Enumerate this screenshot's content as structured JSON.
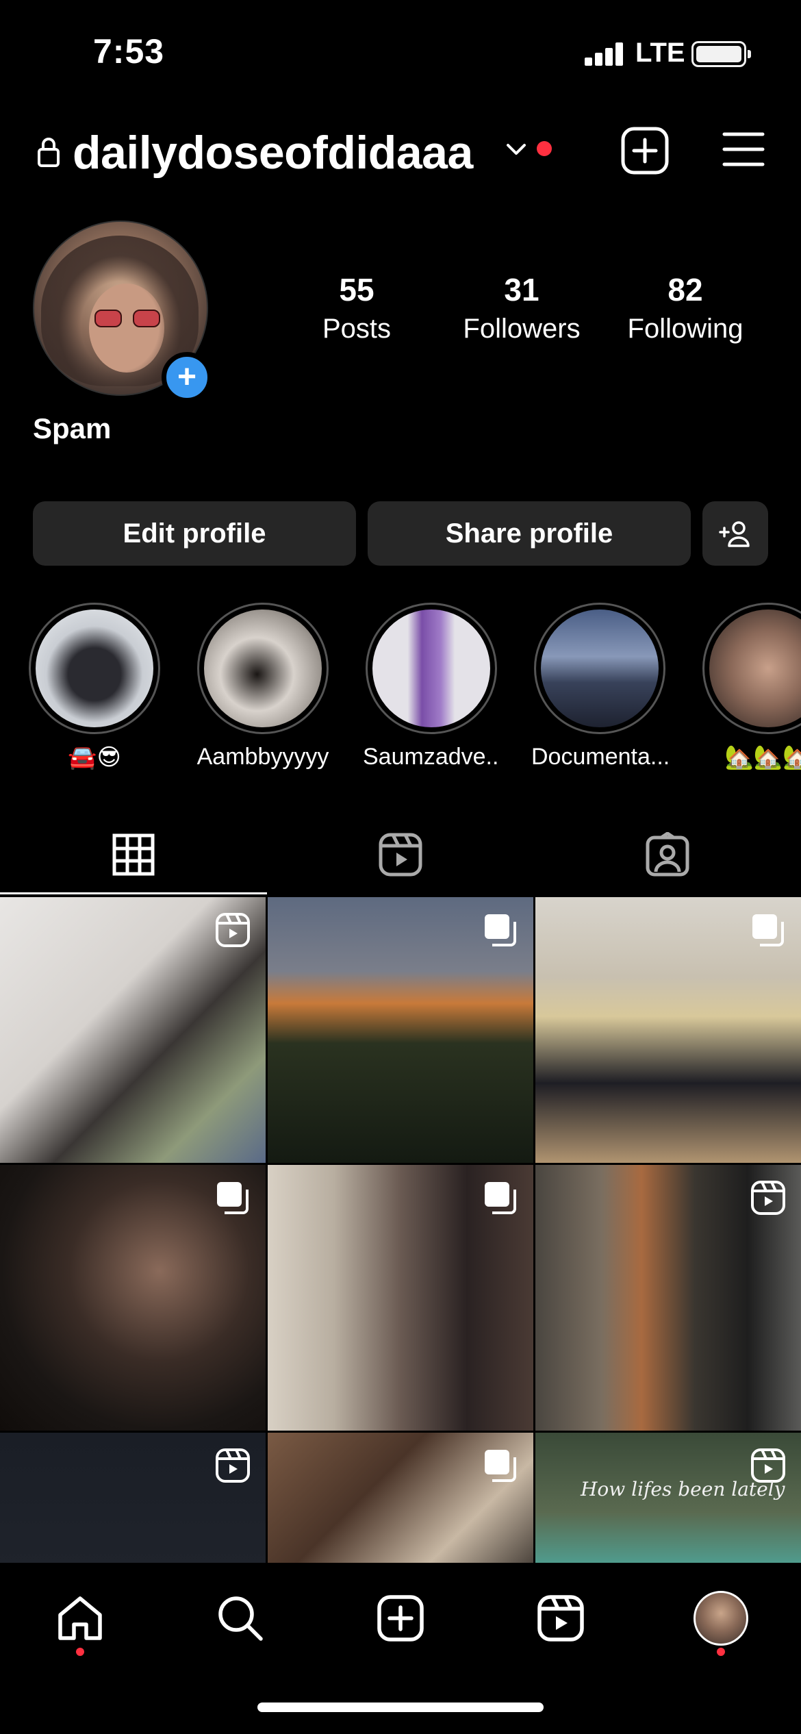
{
  "status_bar": {
    "time": "7:53",
    "network": "LTE"
  },
  "header": {
    "username": "dailydoseofdidaaa"
  },
  "profile": {
    "display_name": "Spam",
    "stats": [
      {
        "value": "55",
        "label": "Posts"
      },
      {
        "value": "31",
        "label": "Followers"
      },
      {
        "value": "82",
        "label": "Following"
      }
    ]
  },
  "buttons": {
    "edit": "Edit profile",
    "share": "Share profile"
  },
  "highlights": [
    {
      "label": "🚘😎"
    },
    {
      "label": "Aambbyyyyy"
    },
    {
      "label": "Saumzadve..."
    },
    {
      "label": "Documenta..."
    },
    {
      "label": "🏡🏡🏡"
    }
  ],
  "grid_overlay_text": "How lifes been lately",
  "colors": {
    "accent_blue": "#3897f0",
    "notification_red": "#ff3040",
    "button_bg": "#262626"
  }
}
